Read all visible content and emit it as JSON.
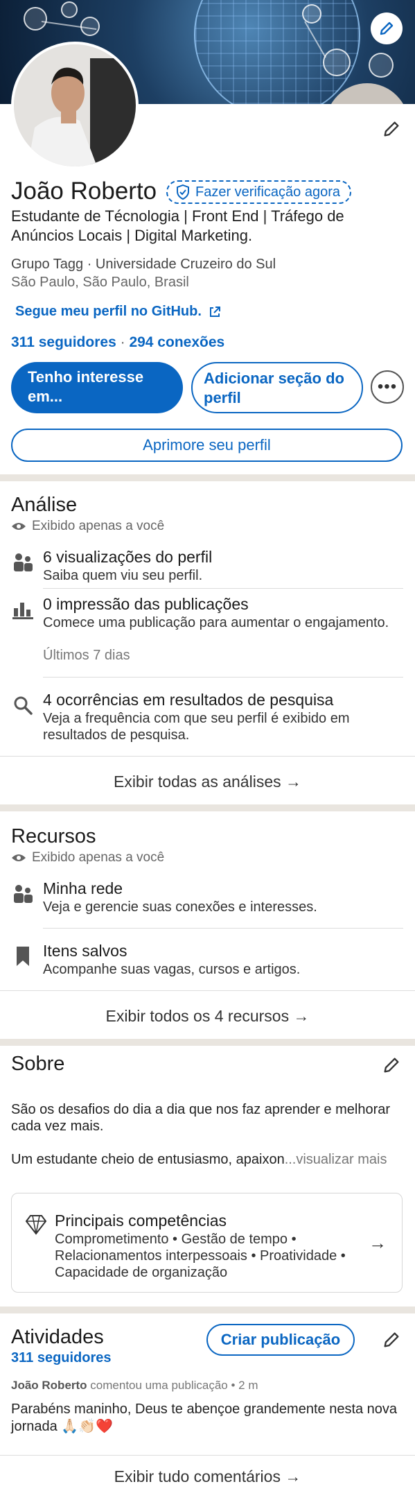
{
  "profile": {
    "name": "João Roberto",
    "verify_label": "Fazer verificação agora",
    "headline": "Estudante de Técnologia | Front End | Tráfego de Anúncios Locais | Digital Marketing.",
    "company": "Grupo Tagg · Universidade Cruzeiro do Sul",
    "location": "São Paulo, São Paulo, Brasil",
    "github_link": "Segue meu perfil no GitHub.",
    "followers": "311 seguidores",
    "separator": "·",
    "connections": "294 conexões"
  },
  "actions": {
    "interest": "Tenho interesse em...",
    "add_section": "Adicionar seção do perfil",
    "more": "•••",
    "improve": "Aprimore seu perfil"
  },
  "analytics": {
    "title": "Análise",
    "private": "Exibido apenas a você",
    "items": [
      {
        "title": "6 visualizações do perfil",
        "desc": "Saiba quem viu seu perfil."
      },
      {
        "title": "0 impressão das publicações",
        "desc": "Comece uma publicação para aumentar o engajamento.",
        "note": "Últimos 7 dias"
      },
      {
        "title": "4 ocorrências em resultados de pesquisa",
        "desc": "Veja a frequência com que seu perfil é exibido em resultados de pesquisa."
      }
    ],
    "footer": "Exibir todas as análises →"
  },
  "resources": {
    "title": "Recursos",
    "private": "Exibido apenas a você",
    "items": [
      {
        "title": "Minha rede",
        "desc": "Veja e gerencie suas conexões e interesses."
      },
      {
        "title": "Itens salvos",
        "desc": "Acompanhe suas vagas, cursos e artigos."
      }
    ],
    "footer": "Exibir todos os 4 recursos →"
  },
  "about": {
    "title": "Sobre",
    "p1": "São os desafios do dia a dia que nos faz aprender e melhorar cada vez mais.",
    "p2": "Um estudante cheio de entusiasmo, apaixon",
    "more": "...visualizar mais",
    "skills_title": "Principais competências",
    "skills": "Comprometimento • Gestão de tempo • Relacionamentos interpessoais • Proatividade • Capacidade de organização",
    "arrow": "→"
  },
  "activity": {
    "title": "Atividades",
    "create": "Criar publicação",
    "followers": "311 seguidores",
    "author": "João Roberto",
    "meta": "comentou uma publicação • 2 m",
    "post": "Parabéns maninho, Deus te abençoe grandemente nesta nova jornada 🙏🏻👏🏻❤️",
    "footer": "Exibir tudo comentários →"
  },
  "colors": {
    "brand": "#0a66c2",
    "separator": "#e9e5df"
  }
}
